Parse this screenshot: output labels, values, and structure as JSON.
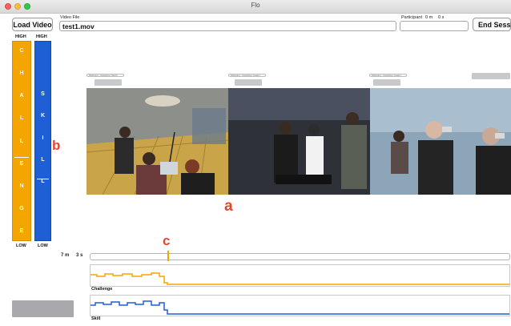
{
  "window": {
    "title": "Flo"
  },
  "toolbar": {
    "load_label": "Load Video",
    "video_file_label": "Video File",
    "video_file_value": "test1.mov",
    "participant_label": "Participant",
    "participant_min": "0 m",
    "participant_sec": "0 s",
    "end_label": "End Session"
  },
  "bars": {
    "challenge": {
      "high": "HIGH",
      "low": "LOW",
      "letters": [
        "C",
        "H",
        "A",
        "L",
        "L",
        "E",
        "N",
        "G",
        "E"
      ],
      "marker_level": 0.58,
      "color": "#f5a500"
    },
    "skill": {
      "high": "HIGH",
      "low": "LOW",
      "letters": [
        "S",
        "K",
        "I",
        "L",
        "L"
      ],
      "marker_level": 0.69,
      "color": "#1f5fd6"
    }
  },
  "video_tabs": [
    "Webcam - Facetime (Web)",
    "Webcam - Facetime (Later)",
    "Webcam - Facetime (Later)"
  ],
  "annotations": {
    "a": "a",
    "b": "b",
    "c": "c"
  },
  "timeline": {
    "minutes": "7 m",
    "seconds": "3 s",
    "playhead_fraction": 0.185
  },
  "plots": {
    "challenge": {
      "label": "Challenge",
      "color": "#f5a500"
    },
    "skill": {
      "label": "Skill",
      "color": "#1f5fd6"
    }
  },
  "colors": {
    "accent_challenge": "#f5a500",
    "accent_skill": "#1f5fd6",
    "annotation": "#e8442e"
  }
}
